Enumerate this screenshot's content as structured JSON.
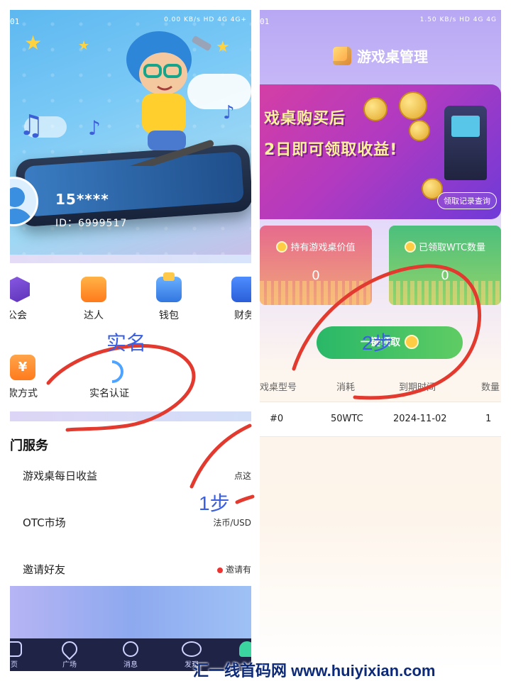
{
  "left": {
    "status_left": "01",
    "status_right": "0.00 KB/s  HD 4G 4G+ ",
    "profile": {
      "name": "15****",
      "id": "ID：6999517"
    },
    "icons_row1": [
      {
        "label": "公会",
        "icon": "guild-icon"
      },
      {
        "label": "达人",
        "icon": "trophy-icon"
      },
      {
        "label": "钱包",
        "icon": "wallet-icon"
      },
      {
        "label": "财务",
        "icon": "finance-icon"
      }
    ],
    "icons_row2": [
      {
        "label": "款方式",
        "icon": "payment-icon",
        "glyph": "¥"
      },
      {
        "label": "实名认证",
        "icon": "verify-icon"
      }
    ],
    "section_title": "门服务",
    "services": [
      {
        "label": "游戏桌每日收益",
        "right": "点这"
      },
      {
        "label": "OTC市场",
        "right": "法币/USD"
      },
      {
        "label": "邀请好友",
        "right": "邀请有"
      }
    ],
    "tabs": [
      {
        "label": "页"
      },
      {
        "label": "广场"
      },
      {
        "label": "消息"
      },
      {
        "label": "发现"
      },
      {
        "label": ""
      }
    ]
  },
  "right": {
    "status_left": "01",
    "status_right": "1.50 KB/s  HD 4G 4G ",
    "title": "游戏桌管理",
    "banner": {
      "line1": "戏桌购买后",
      "line2": "2日即可领取收益!",
      "records_button": "领取记录查询"
    },
    "stats": [
      {
        "label": "持有游戏桌价值",
        "value": "0"
      },
      {
        "label": "已领取WTC数量",
        "value": "0"
      }
    ],
    "claim_button": "一键领取",
    "table": {
      "headers": [
        "戏桌型号",
        "消耗",
        "到期时间",
        "数量"
      ],
      "rows": [
        [
          "#0",
          "50WTC",
          "2024-11-02",
          "1"
        ]
      ]
    }
  },
  "annotations": {
    "realname": "实名",
    "step1": "1步",
    "step2": "2步",
    "watermark": "汇一线首码网 www.huiyixian.com"
  },
  "colors": {
    "annotation_red": "#e23a2f",
    "annotation_blue": "#3a5fe0",
    "claim_green": "#29b868"
  }
}
